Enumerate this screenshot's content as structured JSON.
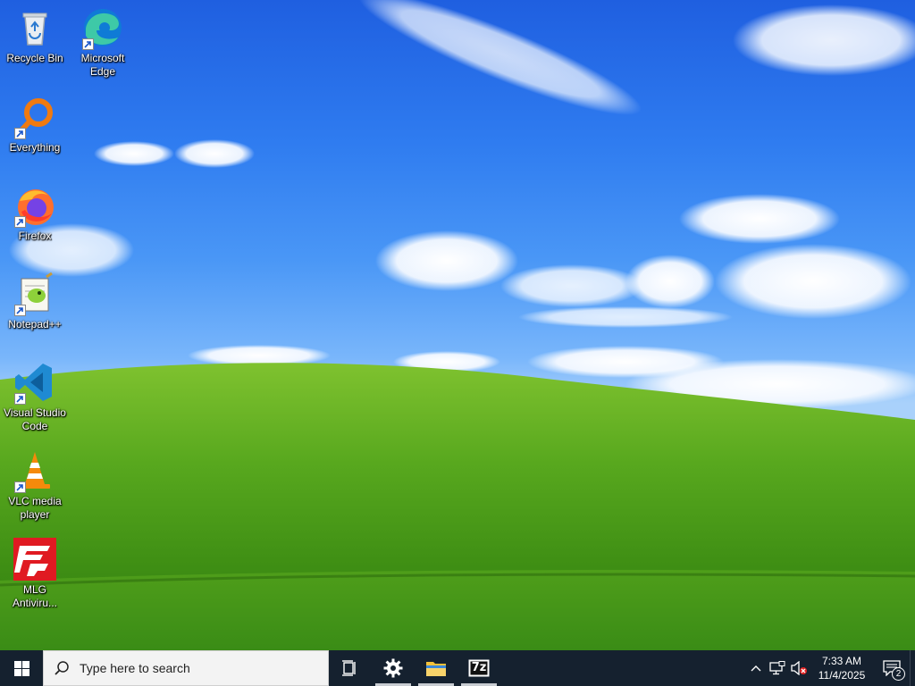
{
  "desktop": {
    "icons": [
      {
        "label": "Recycle Bin",
        "icon": "recycle-bin-icon",
        "shortcut": false
      },
      {
        "label": "Microsoft Edge",
        "icon": "edge-icon",
        "shortcut": true
      },
      {
        "label": "Everything",
        "icon": "everything-icon",
        "shortcut": true
      },
      {
        "label": "Firefox",
        "icon": "firefox-icon",
        "shortcut": true
      },
      {
        "label": "Notepad++",
        "icon": "notepadpp-icon",
        "shortcut": true
      },
      {
        "label": "Visual Studio Code",
        "icon": "vscode-icon",
        "shortcut": true
      },
      {
        "label": "VLC media player",
        "icon": "vlc-icon",
        "shortcut": true
      },
      {
        "label": "MLG Antiviru...",
        "icon": "mlg-antivirus-icon",
        "shortcut": false
      }
    ]
  },
  "taskbar": {
    "search_placeholder": "Type here to search",
    "pinned": [
      {
        "name": "task-view",
        "icon": "task-view-icon",
        "running": false
      },
      {
        "name": "settings",
        "icon": "gear-icon",
        "running": true
      },
      {
        "name": "file-explorer",
        "icon": "folder-icon",
        "running": true
      },
      {
        "name": "7-zip",
        "icon": "7zip-icon",
        "running": true
      }
    ],
    "sevenzip_label": "7z",
    "clock": {
      "time": "7:33 AM",
      "date": "11/4/2025"
    },
    "notification_count": "2"
  },
  "colors": {
    "taskbar": "#15212f",
    "sky_top": "#1f5fe0",
    "grass": "#4c9a1a",
    "start_icon": "#ffffff"
  }
}
